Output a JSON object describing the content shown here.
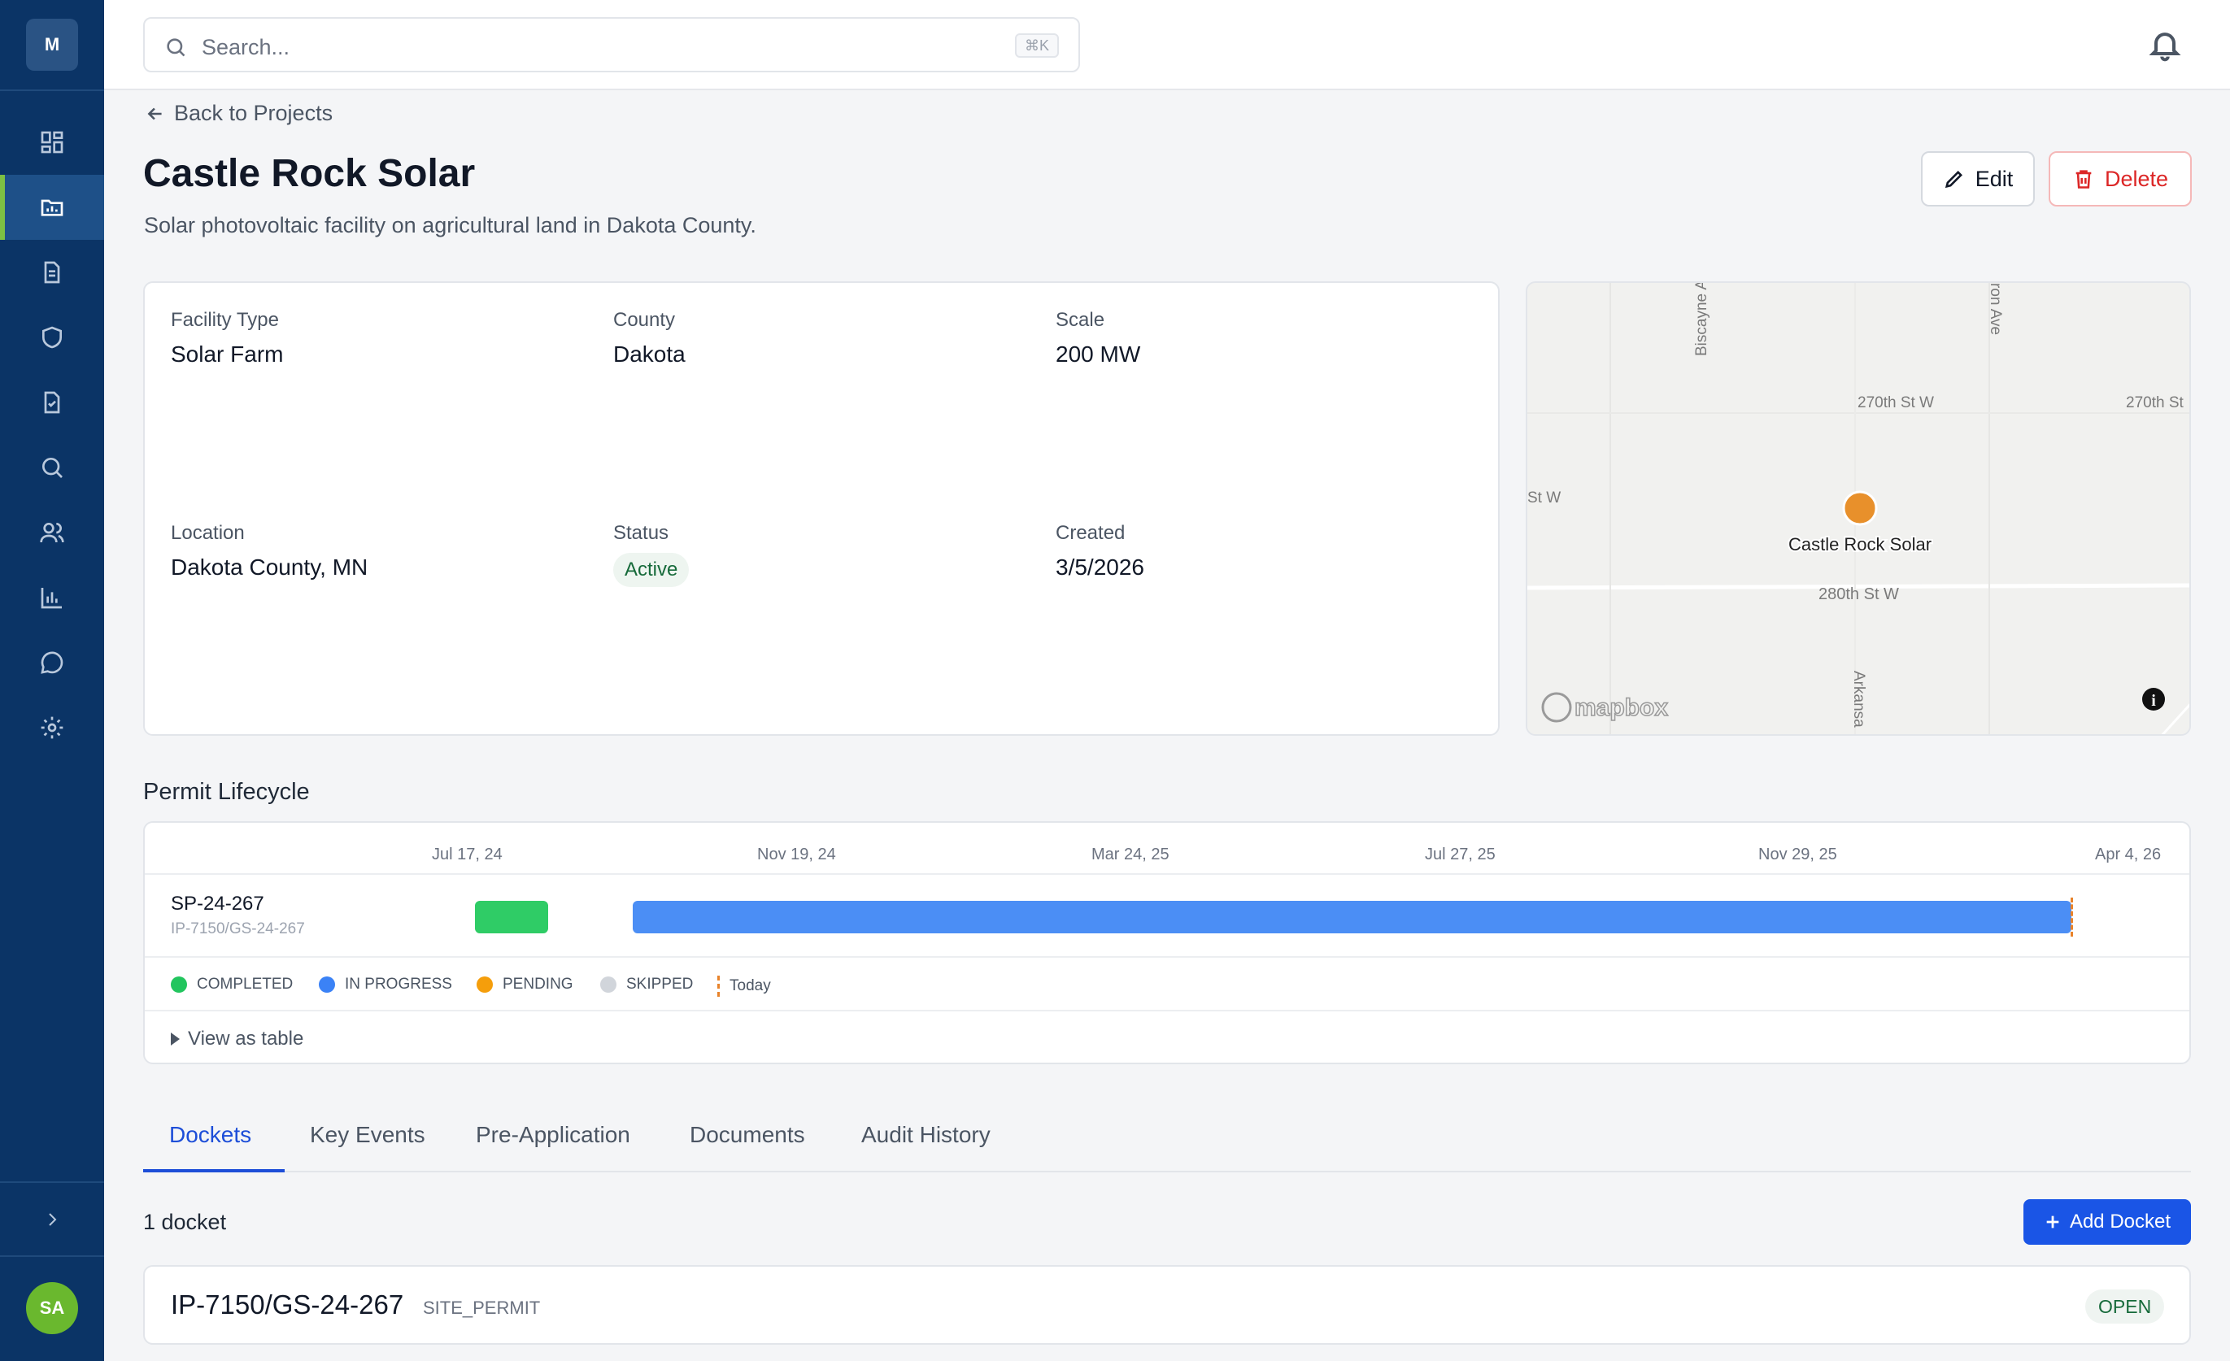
{
  "sidebar": {
    "logo": "M",
    "avatar": "SA",
    "items": [
      {
        "icon": "dashboard-icon"
      },
      {
        "icon": "projects-icon",
        "active": true
      },
      {
        "icon": "document-icon"
      },
      {
        "icon": "shield-icon"
      },
      {
        "icon": "checklist-icon"
      },
      {
        "icon": "search-icon"
      },
      {
        "icon": "users-icon"
      },
      {
        "icon": "chart-icon"
      },
      {
        "icon": "chat-icon"
      },
      {
        "icon": "settings-icon"
      }
    ],
    "expand_icon": "chevron-right-icon"
  },
  "header": {
    "search_placeholder": "Search...",
    "shortcut": "⌘K",
    "bell_icon": "bell-icon"
  },
  "page": {
    "back_label": "Back to Projects",
    "title": "Castle Rock Solar",
    "subtitle": "Solar photovoltaic facility on agricultural land in Dakota County.",
    "edit_label": "Edit",
    "delete_label": "Delete"
  },
  "details": {
    "facility_type_label": "Facility Type",
    "facility_type_value": "Solar Farm",
    "county_label": "County",
    "county_value": "Dakota",
    "scale_label": "Scale",
    "scale_value": "200 MW",
    "location_label": "Location",
    "location_value": "Dakota County, MN",
    "status_label": "Status",
    "status_value": "Active",
    "created_label": "Created",
    "created_value": "3/5/2026"
  },
  "map": {
    "marker_label": "Castle Rock Solar",
    "streets": [
      "Biscayne A",
      "ron Ave",
      "270th St W",
      "270th St",
      "St W",
      "280th St W",
      "Arkansa"
    ],
    "attribution": "mapbox",
    "marker_color": "#e8902b"
  },
  "lifecycle": {
    "section_title": "Permit Lifecycle",
    "axis_ticks": [
      "Jul 17, 24",
      "Nov 19, 24",
      "Mar 24, 25",
      "Jul 27, 25",
      "Nov 29, 25",
      "Apr 4, 26"
    ],
    "row": {
      "id": "SP-24-267",
      "sub": "IP-7150/GS-24-267",
      "segments": [
        {
          "status": "COMPLETED",
          "start": "2024-07-17",
          "end": "2024-08-10"
        },
        {
          "status": "IN PROGRESS",
          "start": "2024-08-15",
          "end": "2026-03-05"
        }
      ]
    },
    "legend": [
      {
        "label": "COMPLETED",
        "color": "#22c55e"
      },
      {
        "label": "IN PROGRESS",
        "color": "#3b82f6"
      },
      {
        "label": "PENDING",
        "color": "#f59e0b"
      },
      {
        "label": "SKIPPED",
        "color": "#d1d5db"
      }
    ],
    "today_label": "Today",
    "view_table_label": "View as table"
  },
  "tabs": [
    {
      "label": "Dockets",
      "active": true
    },
    {
      "label": "Key Events"
    },
    {
      "label": "Pre-Application"
    },
    {
      "label": "Documents"
    },
    {
      "label": "Audit History"
    }
  ],
  "dockets": {
    "count_label": "1 docket",
    "add_label": "Add Docket",
    "items": [
      {
        "id": "IP-7150/GS-24-267",
        "type": "SITE_PERMIT",
        "status": "OPEN"
      }
    ]
  }
}
